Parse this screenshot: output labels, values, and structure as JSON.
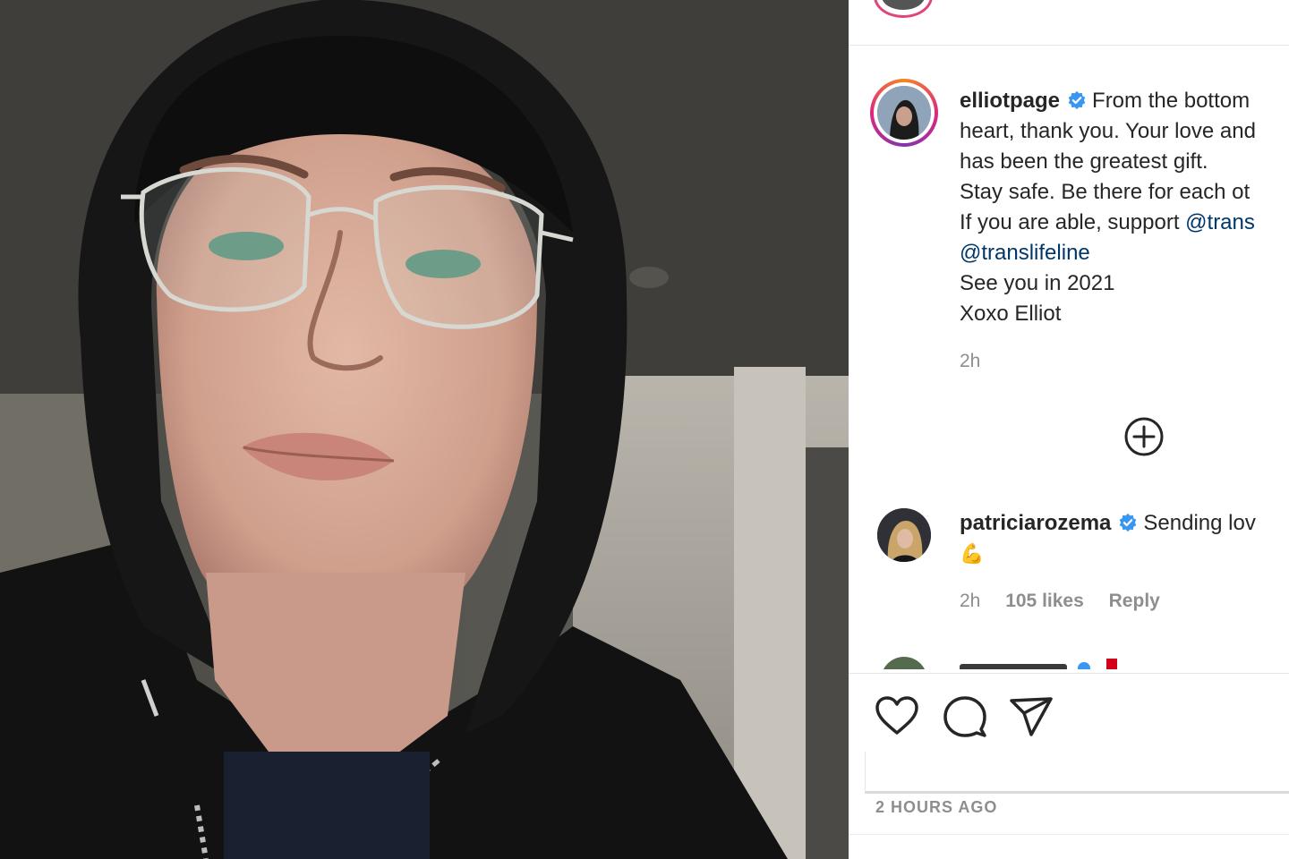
{
  "post": {
    "author": "elliotpage",
    "caption_first": "From the bottom",
    "caption_lines": [
      "heart, thank you. Your love and",
      "has been the greatest gift.",
      "Stay safe. Be there for each ot"
    ],
    "support_prefix": "If you are able, support ",
    "support_mention": "@trans",
    "mention_line": "@translifeline",
    "closing_lines": [
      "See you in 2021",
      "Xoxo Elliot"
    ],
    "age": "2h"
  },
  "comment": {
    "author": "patriciarozema",
    "text": "Sending lov",
    "emoji": "💪",
    "age": "2h",
    "likes": "105 likes",
    "reply": "Reply"
  },
  "footer": {
    "timestamp": "2 HOURS AGO"
  },
  "icons": {
    "like": "heart-icon",
    "comment": "speech-bubble-icon",
    "share": "paper-plane-icon",
    "load_more": "plus-circle-icon",
    "verified": "verified-badge-icon"
  },
  "colors": {
    "mention": "#00376b",
    "verified": "#3897f0",
    "muted": "#8e8e8e",
    "text": "#262626"
  }
}
